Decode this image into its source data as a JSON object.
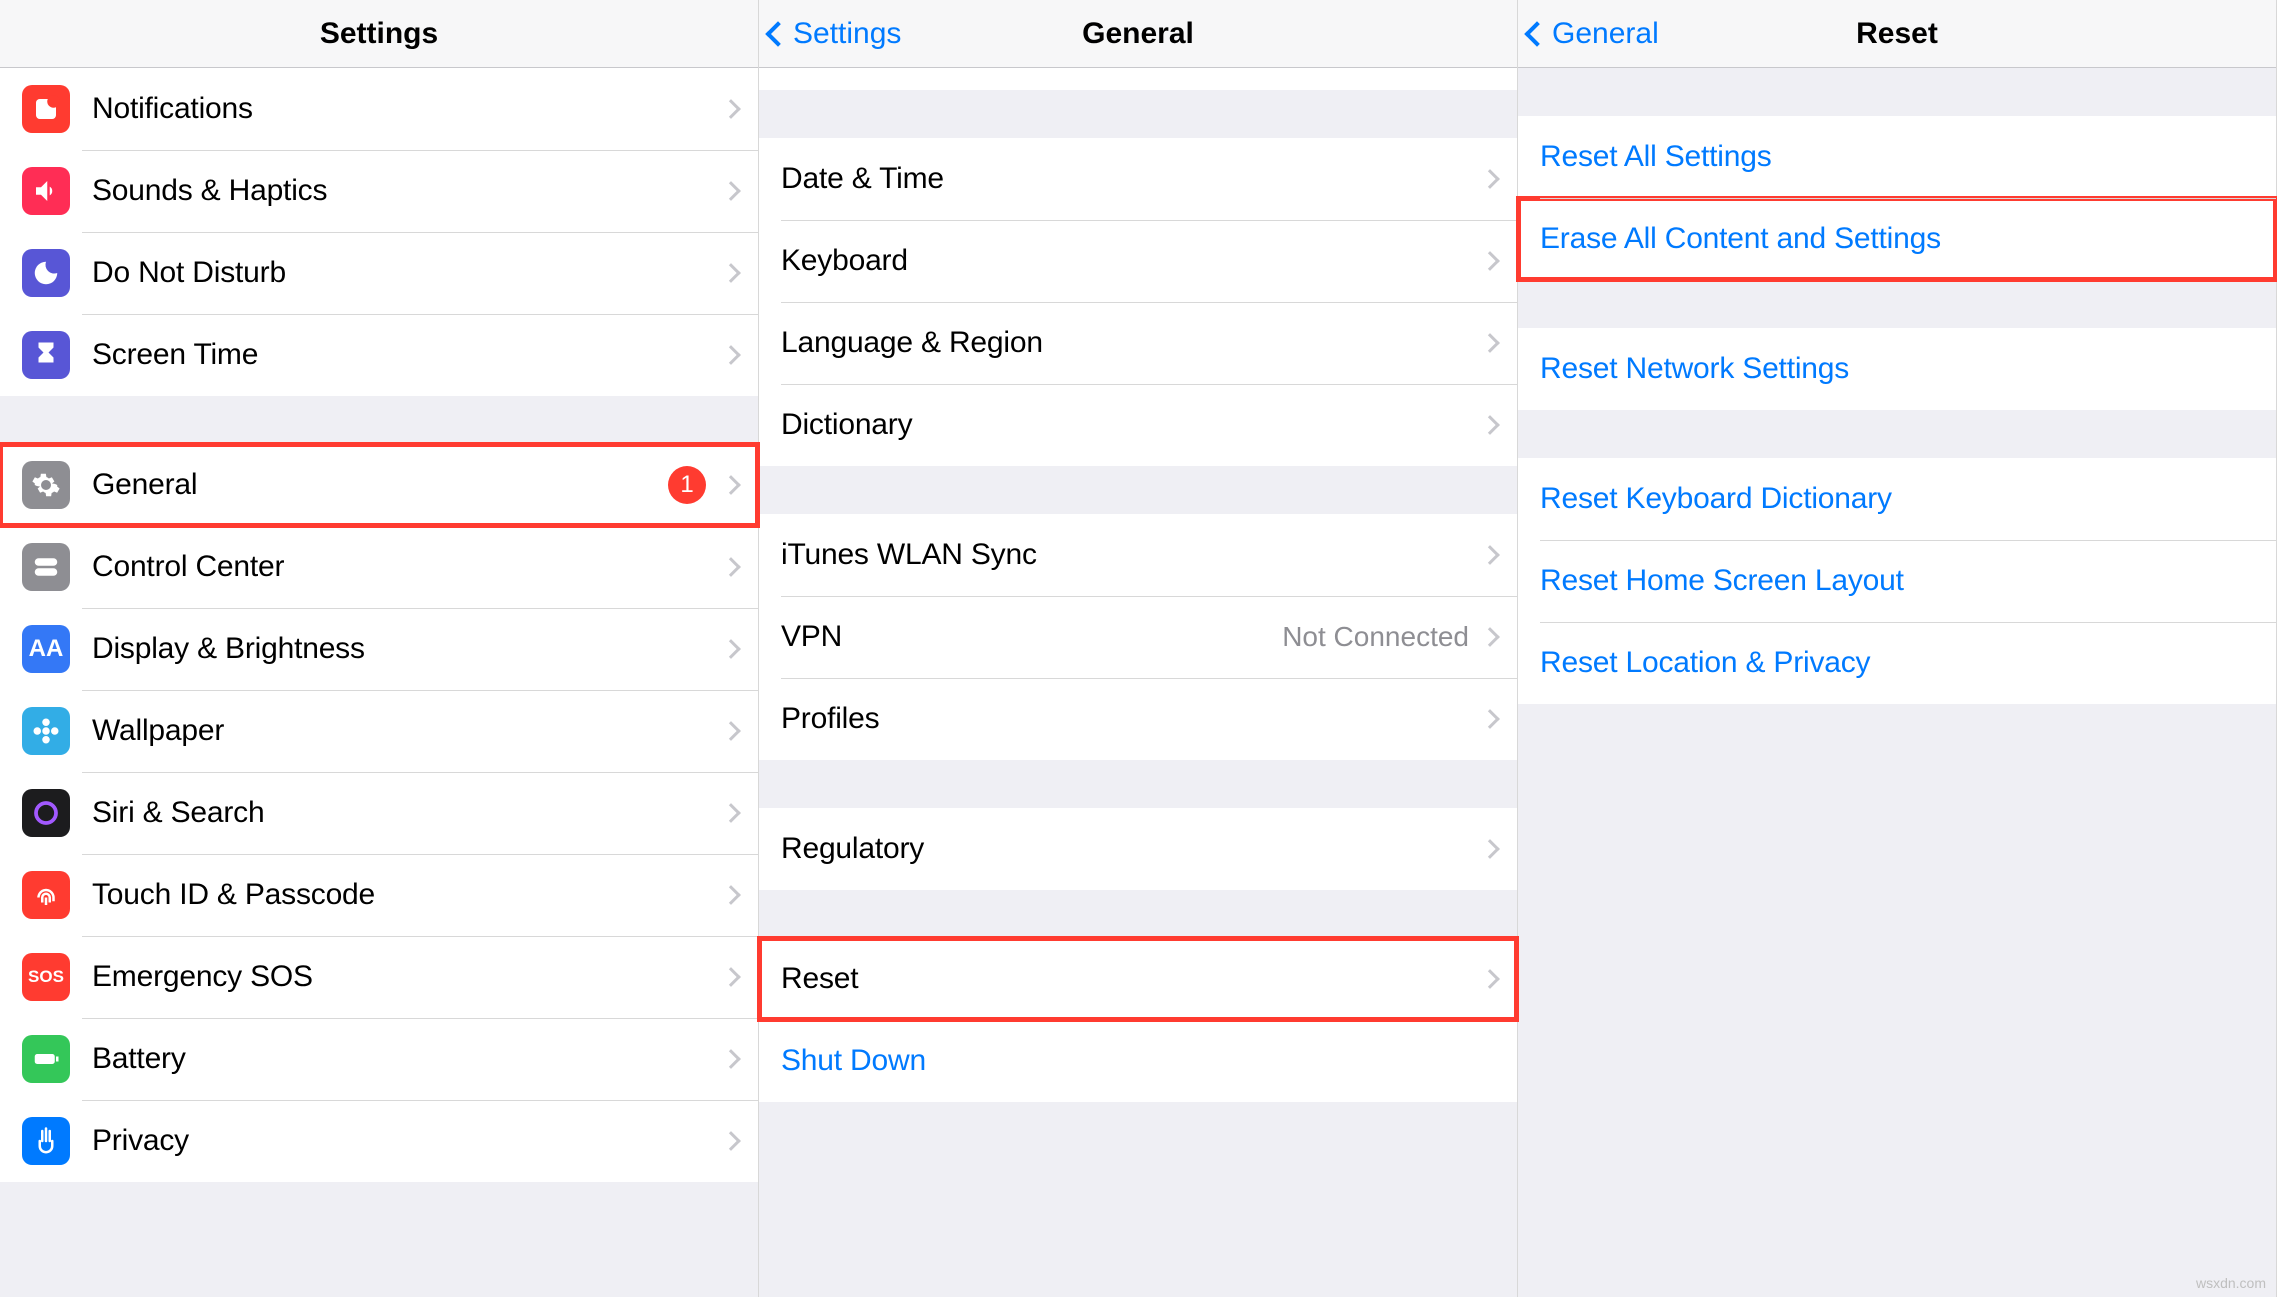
{
  "panel1": {
    "title": "Settings",
    "items1": [
      {
        "label": "Notifications"
      },
      {
        "label": "Sounds & Haptics"
      },
      {
        "label": "Do Not Disturb"
      },
      {
        "label": "Screen Time"
      }
    ],
    "items2": [
      {
        "label": "General",
        "badge": "1"
      },
      {
        "label": "Control Center"
      },
      {
        "label": "Display & Brightness"
      },
      {
        "label": "Wallpaper"
      },
      {
        "label": "Siri & Search"
      },
      {
        "label": "Touch ID & Passcode"
      },
      {
        "label": "Emergency SOS"
      },
      {
        "label": "Battery"
      },
      {
        "label": "Privacy"
      }
    ]
  },
  "panel2": {
    "back": "Settings",
    "title": "General",
    "group1": [
      {
        "label": "Date & Time"
      },
      {
        "label": "Keyboard"
      },
      {
        "label": "Language & Region"
      },
      {
        "label": "Dictionary"
      }
    ],
    "group2": [
      {
        "label": "iTunes WLAN Sync"
      },
      {
        "label": "VPN",
        "value": "Not Connected"
      },
      {
        "label": "Profiles"
      }
    ],
    "group3": [
      {
        "label": "Regulatory"
      }
    ],
    "group4": [
      {
        "label": "Reset"
      },
      {
        "label": "Shut Down",
        "blue": true,
        "noChevron": true
      }
    ]
  },
  "panel3": {
    "back": "General",
    "title": "Reset",
    "group1": [
      {
        "label": "Reset All Settings"
      },
      {
        "label": "Erase All Content and Settings",
        "highlight": true
      }
    ],
    "group2": [
      {
        "label": "Reset Network Settings"
      }
    ],
    "group3": [
      {
        "label": "Reset Keyboard Dictionary"
      },
      {
        "label": "Reset Home Screen Layout"
      },
      {
        "label": "Reset Location & Privacy"
      }
    ]
  },
  "watermark": "wsxdn.com"
}
